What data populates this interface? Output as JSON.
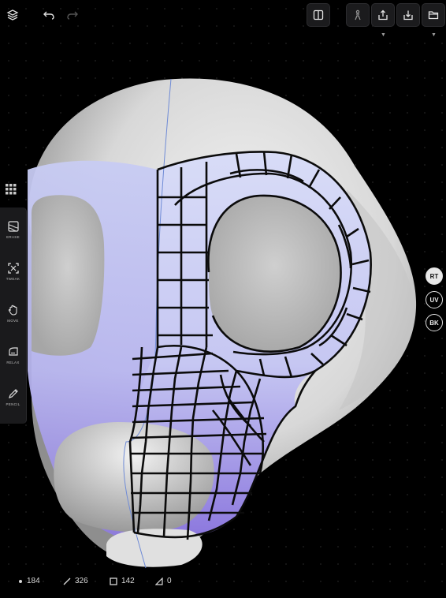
{
  "stats": {
    "vertices": "184",
    "edges": "326",
    "faces": "142",
    "triangles": "0"
  },
  "view_modes": {
    "rt": "RT",
    "uv": "UV",
    "bk": "BK",
    "active": "RT"
  },
  "tools": [
    {
      "label": "ERASE",
      "icon": "erase-icon"
    },
    {
      "label": "TWEAK",
      "icon": "tweak-icon"
    },
    {
      "label": "MOVE",
      "icon": "move-hand-icon"
    },
    {
      "label": "RELAX",
      "icon": "relax-iron-icon"
    },
    {
      "label": "PENCIL",
      "icon": "pencil-icon"
    }
  ],
  "colors": {
    "background": "#000000",
    "mesh_fill": "#cdd3f5",
    "mesh_fill_lower": "#8f7be0",
    "wireframe": "#0b0b0b",
    "model_base": "#e8e8e8"
  }
}
